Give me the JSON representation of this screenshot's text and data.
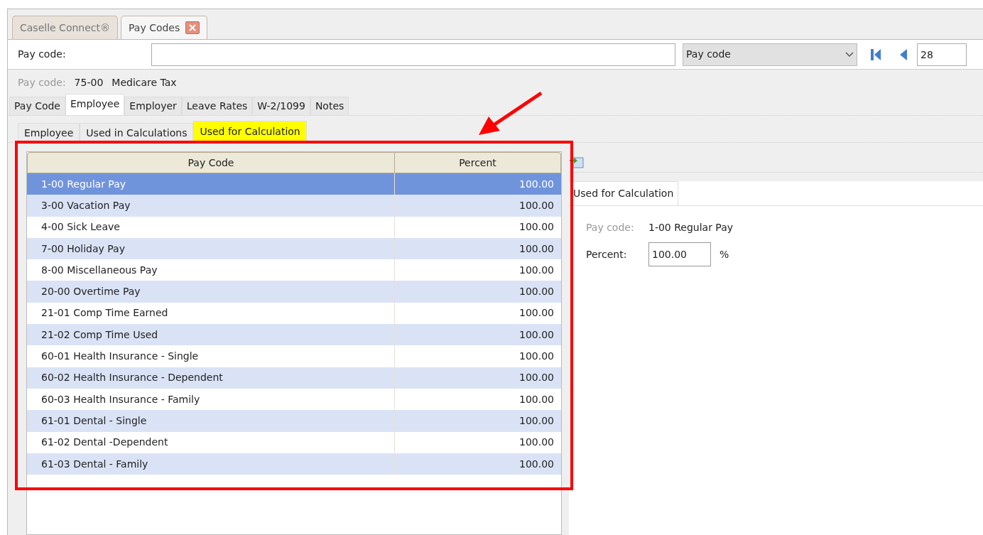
{
  "doc_tabs": [
    {
      "label": "Caselle Connect®",
      "selected": false,
      "closable": false
    },
    {
      "label": "Pay Codes",
      "selected": true,
      "closable": true
    }
  ],
  "search": {
    "label": "Pay code:",
    "dropdown": "Pay code",
    "record": "28"
  },
  "info": {
    "label": "Pay code:",
    "code": "75-00",
    "name": "Medicare Tax"
  },
  "tabs": [
    {
      "label": "Pay Code",
      "selected": false
    },
    {
      "label": "Employee",
      "selected": true
    },
    {
      "label": "Employer",
      "selected": false
    },
    {
      "label": "Leave Rates",
      "selected": false
    },
    {
      "label": "W-2/1099",
      "selected": false
    },
    {
      "label": "Notes",
      "selected": false
    }
  ],
  "sub_tabs": [
    {
      "label": "Employee",
      "selected": false,
      "highlighted": false
    },
    {
      "label": "Used in Calculations",
      "selected": false,
      "highlighted": false
    },
    {
      "label": "Used for Calculation",
      "selected": true,
      "highlighted": true
    }
  ],
  "table": {
    "columns": [
      "Pay Code",
      "Percent"
    ],
    "rows": [
      {
        "code": "1-00 Regular Pay",
        "percent": "100.00",
        "selected": true
      },
      {
        "code": "3-00 Vacation Pay",
        "percent": "100.00",
        "selected": false
      },
      {
        "code": "4-00 Sick Leave",
        "percent": "100.00",
        "selected": false
      },
      {
        "code": "7-00 Holiday Pay",
        "percent": "100.00",
        "selected": false
      },
      {
        "code": "8-00 Miscellaneous Pay",
        "percent": "100.00",
        "selected": false
      },
      {
        "code": "20-00 Overtime Pay",
        "percent": "100.00",
        "selected": false
      },
      {
        "code": "21-01 Comp Time Earned",
        "percent": "100.00",
        "selected": false
      },
      {
        "code": "21-02 Comp Time Used",
        "percent": "100.00",
        "selected": false
      },
      {
        "code": "60-01 Health Insurance - Single",
        "percent": "100.00",
        "selected": false
      },
      {
        "code": "60-02 Health Insurance - Dependent",
        "percent": "100.00",
        "selected": false
      },
      {
        "code": "60-03 Health Insurance - Family",
        "percent": "100.00",
        "selected": false
      },
      {
        "code": "61-01 Dental - Single",
        "percent": "100.00",
        "selected": false
      },
      {
        "code": "61-02 Dental -Dependent",
        "percent": "100.00",
        "selected": false
      },
      {
        "code": "61-03 Dental - Family",
        "percent": "100.00",
        "selected": false
      }
    ]
  },
  "detail": {
    "tab": "Used for Calculation",
    "code_label": "Pay code:",
    "code_value": "1-00 Regular Pay",
    "percent_label": "Percent:",
    "percent_value": "100.00",
    "unit": "%"
  }
}
